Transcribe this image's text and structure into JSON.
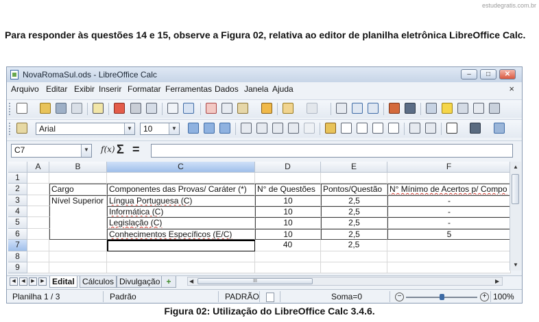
{
  "watermark": "estudegratis.com.br",
  "question": "Para responder às questões 14 e 15, observe a Figura 02, relativa ao editor de planilha eletrônica LibreOffice Calc.",
  "caption": "Figura 02: Utilização do LibreOffice Calc 3.4.6.",
  "window": {
    "title": "NovaRomaSul.ods - LibreOffice Calc",
    "controls": {
      "minimize": "–",
      "maximize": "□",
      "close": "✕"
    }
  },
  "menu": [
    "Arquivo",
    "Editar",
    "Exibir",
    "Inserir",
    "Formatar",
    "Ferramentas",
    "Dados",
    "Janela",
    "Ajuda"
  ],
  "menu_close": "×",
  "formatting": {
    "font_name": "Arial",
    "font_size": "10"
  },
  "formula_bar": {
    "cell_ref": "C7",
    "fx": "f(x)",
    "sum": "Σ",
    "equals": "=",
    "content": ""
  },
  "columns": [
    "A",
    "B",
    "C",
    "D",
    "E",
    "F"
  ],
  "rows": [
    "1",
    "2",
    "3",
    "4",
    "5",
    "6",
    "7",
    "8",
    "9"
  ],
  "cells": {
    "B2": "Cargo",
    "C2": "Componentes das Provas/ Caráter (*)",
    "D2": "N° de Questões",
    "E2": "Pontos/Questão",
    "F2": "N° Mínimo de Acertos p/ Compo",
    "B3": "Nível Superior",
    "C3": "Língua Portuguesa (C)",
    "D3": "10",
    "E3": "2,5",
    "F3": "-",
    "C4": "Informática (C)",
    "D4": "10",
    "E4": "2,5",
    "F4": "-",
    "C5": "Legislação (C)",
    "D5": "10",
    "E5": "2,5",
    "F5": "-",
    "C6": "Conhecimentos Específicos (E/C)",
    "D6": "10",
    "E6": "2,5",
    "F6": "5",
    "D7": "40",
    "E7": "2,5"
  },
  "sheets": [
    "Edital",
    "Cálculos",
    "Divulgação"
  ],
  "add_sheet": "+",
  "hscroll_grip": "III",
  "status": {
    "sheet": "Planilha 1 / 3",
    "style": "Padrão",
    "mode": "PADRÃO",
    "sum": "Soma=0",
    "zoom": "100%",
    "zoom_level": 0.5
  },
  "colors": {
    "selection": "#9fbfea",
    "accent": "#3d6aa5",
    "spell_error": "#d23b2f"
  }
}
